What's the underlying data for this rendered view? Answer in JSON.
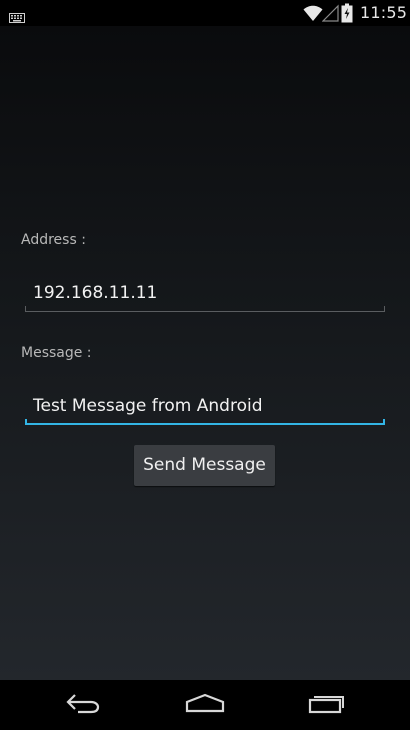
{
  "status_bar": {
    "time": "11:55",
    "icons": [
      "keyboard-icon",
      "wifi-icon",
      "signal-icon",
      "battery-icon"
    ]
  },
  "form": {
    "address_label": "Address :",
    "address_value": "192.168.11.11",
    "message_label": "Message :",
    "message_value": "Test Message from Android",
    "send_button_label": "Send Message"
  },
  "nav_bar": {
    "icons": [
      "back-icon",
      "home-icon",
      "recent-apps-icon"
    ]
  },
  "colors": {
    "accent": "#33b5e5",
    "button_bg": "#3a3d41",
    "background": "#000000"
  }
}
